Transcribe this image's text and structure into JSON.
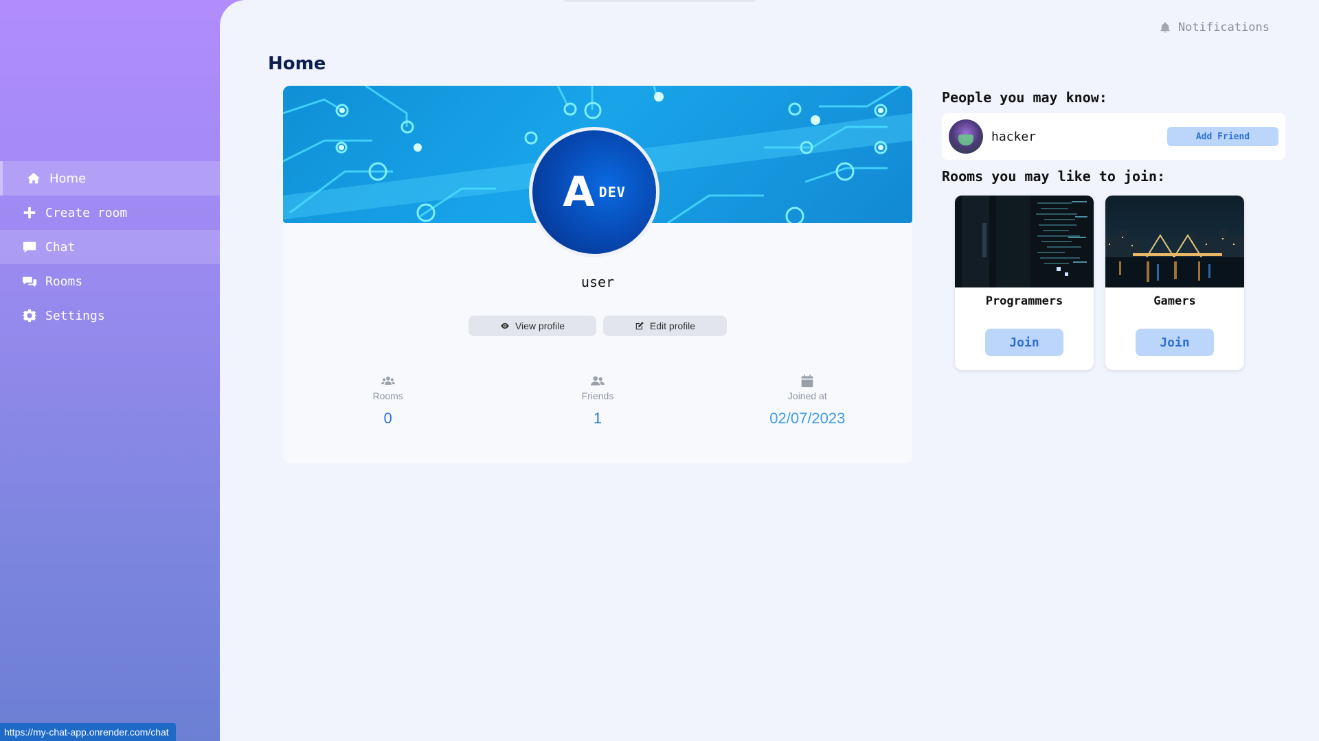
{
  "sidebar": {
    "items": [
      {
        "label": "Home",
        "icon": "home-icon"
      },
      {
        "label": "Create room",
        "icon": "plus-icon"
      },
      {
        "label": "Chat",
        "icon": "chat-icon"
      },
      {
        "label": "Rooms",
        "icon": "comments-icon"
      },
      {
        "label": "Settings",
        "icon": "gear-icon"
      }
    ]
  },
  "header": {
    "notifications_label": "Notifications",
    "page_title": "Home"
  },
  "profile": {
    "username": "user",
    "avatar_logo_letter": "A",
    "avatar_logo_text": "DEV",
    "view_profile_label": "View profile",
    "edit_profile_label": "Edit profile",
    "stats": [
      {
        "label": "Rooms",
        "value": "0",
        "icon": "users-group-icon"
      },
      {
        "label": "Friends",
        "value": "1",
        "icon": "user-friends-icon"
      },
      {
        "label": "Joined at",
        "value": "02/07/2023",
        "icon": "calendar-icon"
      }
    ]
  },
  "suggestions": {
    "people_heading": "People you may know:",
    "people": [
      {
        "name": "hacker",
        "action_label": "Add Friend"
      }
    ],
    "rooms_heading": "Rooms you may like to join:",
    "rooms": [
      {
        "name": "Programmers",
        "join_label": "Join"
      },
      {
        "name": "Gamers",
        "join_label": "Join"
      }
    ]
  },
  "statusbar": {
    "url": "https://my-chat-app.onrender.com/chat"
  },
  "colors": {
    "sidebar_gradient_top": "#b18cfd",
    "sidebar_gradient_bottom": "#6b7fd3",
    "main_bg": "#f1f4fd",
    "accent_blue": "#2d73d9",
    "button_blue_bg": "#bcd6fb"
  }
}
